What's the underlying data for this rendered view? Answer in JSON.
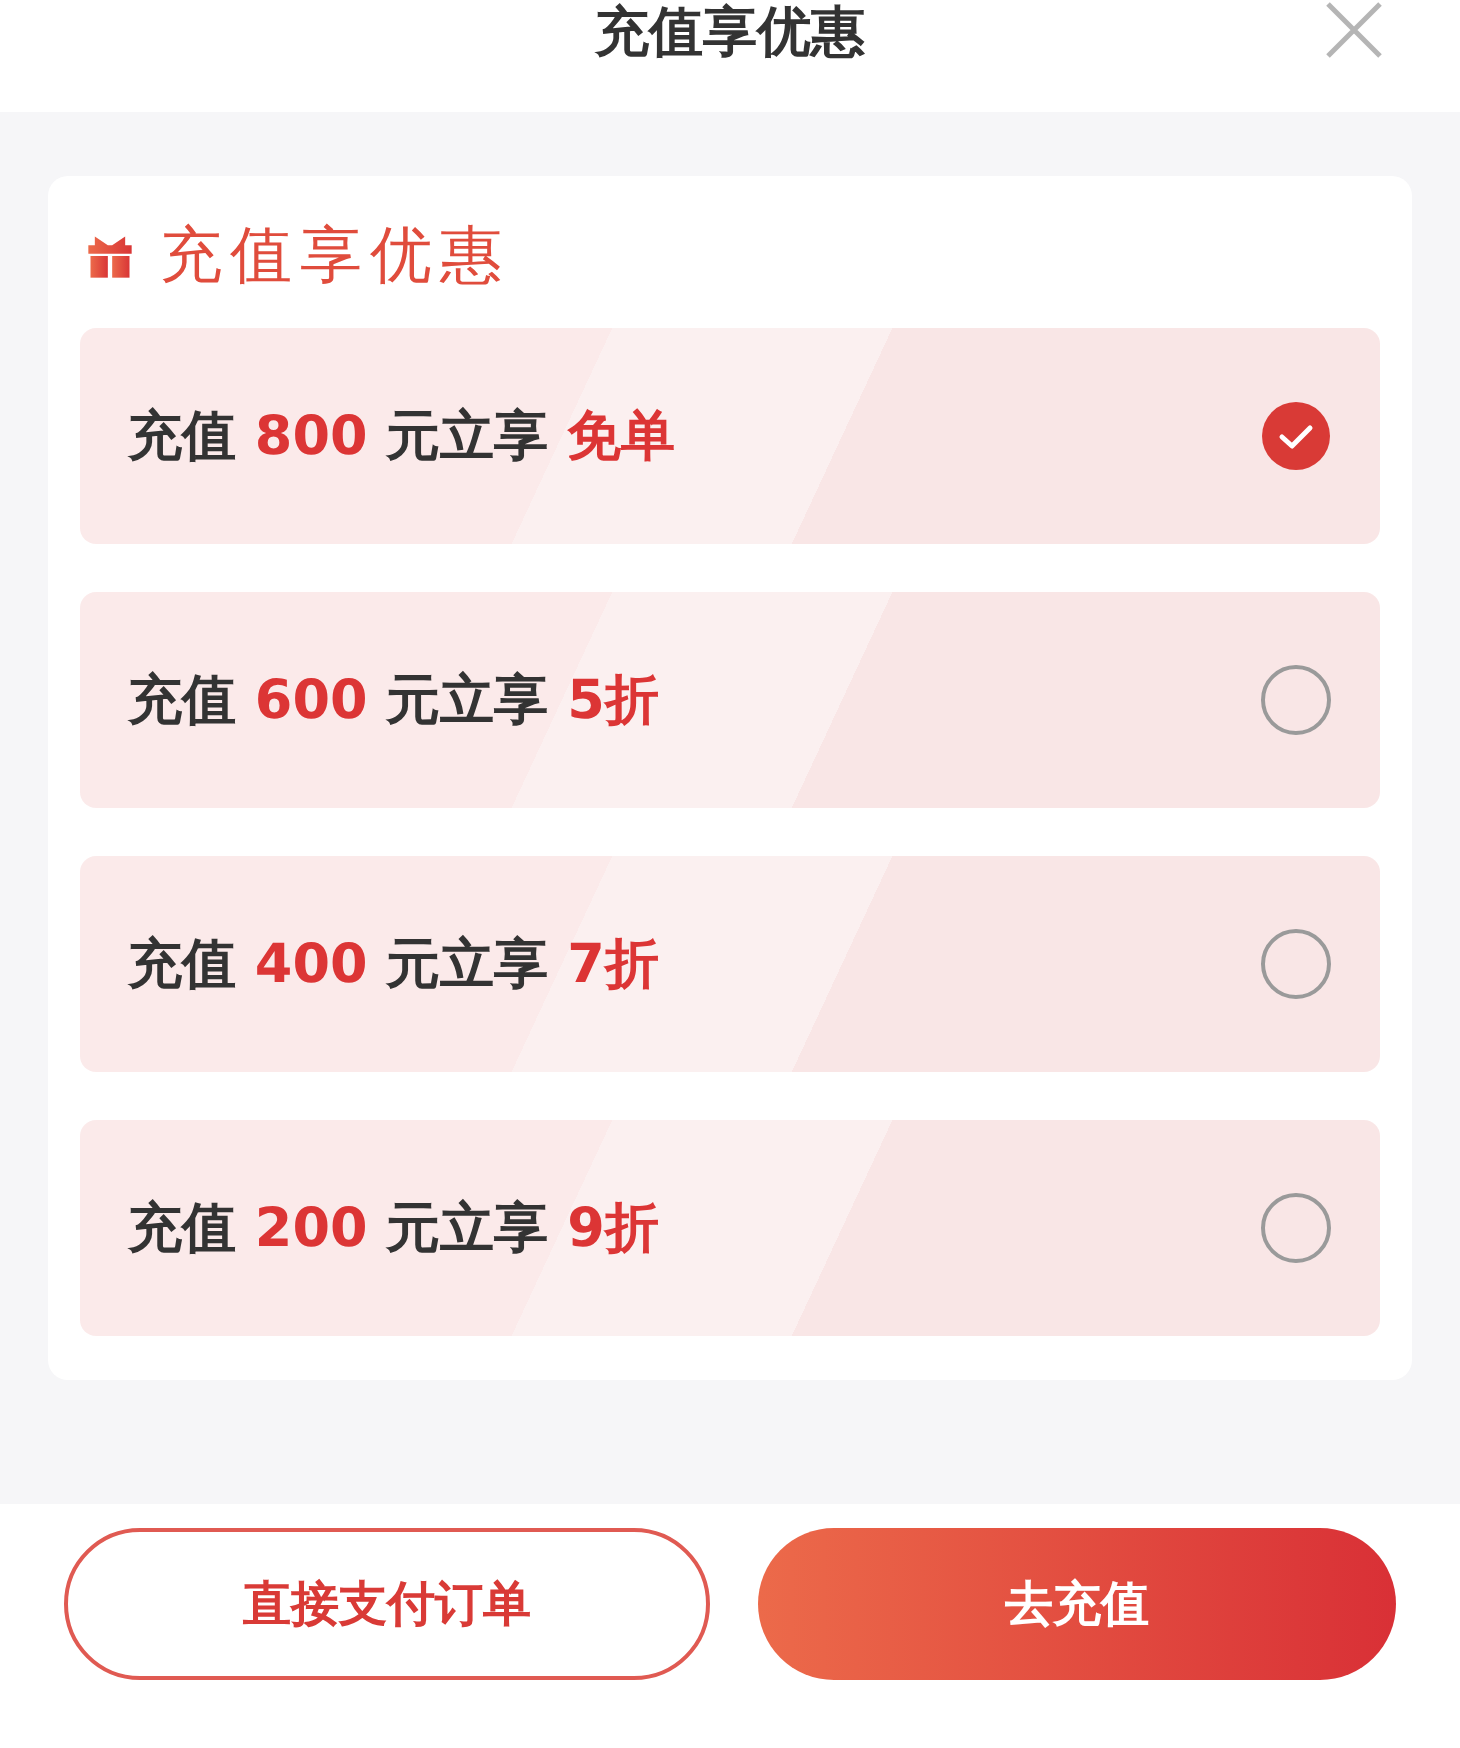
{
  "dialog": {
    "title": "充值享优惠"
  },
  "section": {
    "heading": "充值享优惠"
  },
  "options": [
    {
      "prefix": "充值",
      "amount": "800",
      "middle": "元立享",
      "benefit": "免单",
      "selected": true
    },
    {
      "prefix": "充值",
      "amount": "600",
      "middle": "元立享",
      "benefit": "5折",
      "selected": false
    },
    {
      "prefix": "充值",
      "amount": "400",
      "middle": "元立享",
      "benefit": "7折",
      "selected": false
    },
    {
      "prefix": "充值",
      "amount": "200",
      "middle": "元立享",
      "benefit": "9折",
      "selected": false
    }
  ],
  "buttons": [
    {
      "label": "直接支付订单",
      "kind": "outline"
    },
    {
      "label": "去充值",
      "kind": "primary"
    }
  ]
}
